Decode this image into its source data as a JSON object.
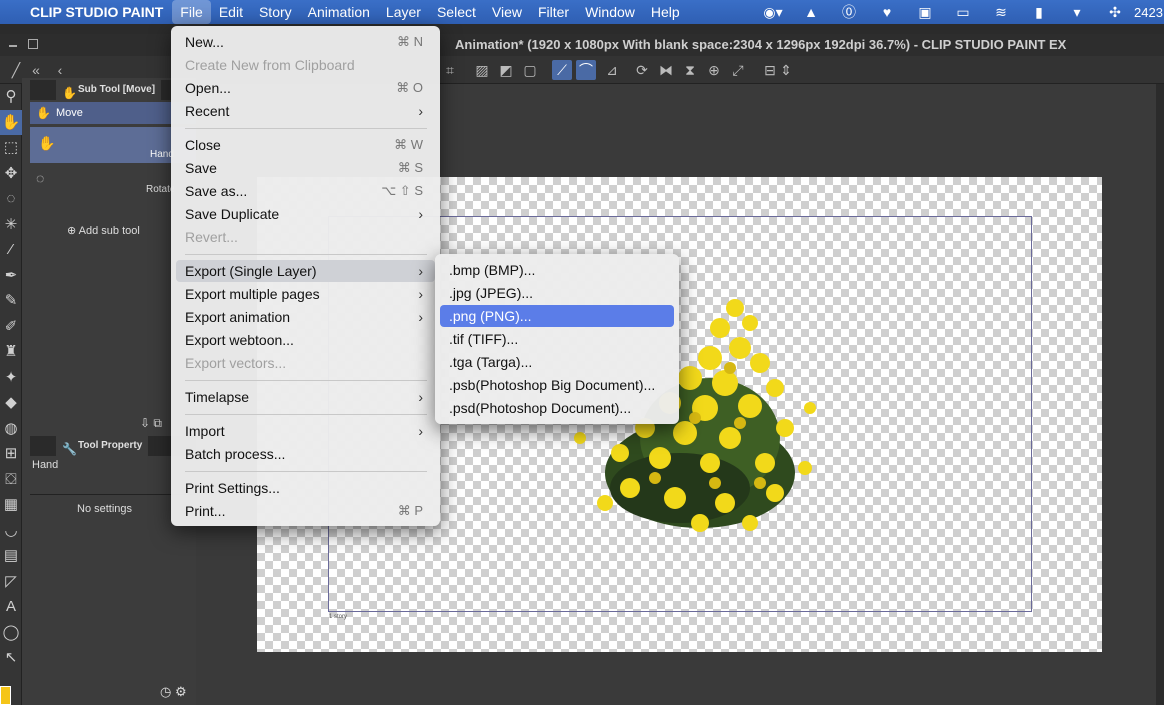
{
  "menubar": {
    "apple_icon": "apple-icon",
    "app_name": "CLIP STUDIO PAINT",
    "items": [
      "File",
      "Edit",
      "Story",
      "Animation",
      "Layer",
      "Select",
      "View",
      "Filter",
      "Window",
      "Help"
    ],
    "active_item": "File",
    "clock": "2423"
  },
  "window": {
    "title": "Animation* (1920 x 1080px With blank space:2304 x 1296px 192dpi 36.7%)  - CLIP STUDIO PAINT EX"
  },
  "subtool_panel": {
    "header": "Sub Tool [Move]",
    "group": "Move",
    "items": [
      "Hand",
      "Rotate"
    ],
    "add_label": "Add sub tool"
  },
  "tool_property_panel": {
    "header": "Tool Property",
    "tool_name": "Hand",
    "empty_label": "No settings"
  },
  "file_menu": {
    "items": [
      {
        "label": "New...",
        "shortcut": "⌘ N"
      },
      {
        "label": "Create New from Clipboard",
        "disabled": true
      },
      {
        "label": "Open...",
        "shortcut": "⌘ O"
      },
      {
        "label": "Recent",
        "submenu": true
      },
      {
        "label": "Close",
        "shortcut": "⌘ W"
      },
      {
        "label": "Save",
        "shortcut": "⌘ S"
      },
      {
        "label": "Save as...",
        "shortcut": "⌥ ⇧ S"
      },
      {
        "label": "Save Duplicate",
        "submenu": true
      },
      {
        "label": "Revert...",
        "disabled": true
      },
      {
        "label": "Export (Single Layer)",
        "submenu": true,
        "highlighted": true
      },
      {
        "label": "Export multiple pages",
        "submenu": true
      },
      {
        "label": "Export animation",
        "submenu": true
      },
      {
        "label": "Export webtoon..."
      },
      {
        "label": "Export vectors...",
        "disabled": true
      },
      {
        "label": "Timelapse",
        "submenu": true
      },
      {
        "label": "Import",
        "submenu": true
      },
      {
        "label": "Batch process..."
      },
      {
        "label": "Print Settings..."
      },
      {
        "label": "Print...",
        "shortcut": "⌘ P"
      }
    ]
  },
  "export_submenu": {
    "items": [
      ".bmp (BMP)...",
      ".jpg (JPEG)...",
      ".png (PNG)...",
      ".tif (TIFF)...",
      ".tga (Targa)...",
      ".psb(Photoshop Big Document)...",
      ".psd(Photoshop Document)..."
    ],
    "selected": ".png (PNG)..."
  },
  "canvas": {
    "frame_label": "1 story"
  },
  "colors": {
    "menubar": "#2f5fb3",
    "selection": "#5b7de8",
    "foreground_color": "#f5c518"
  }
}
